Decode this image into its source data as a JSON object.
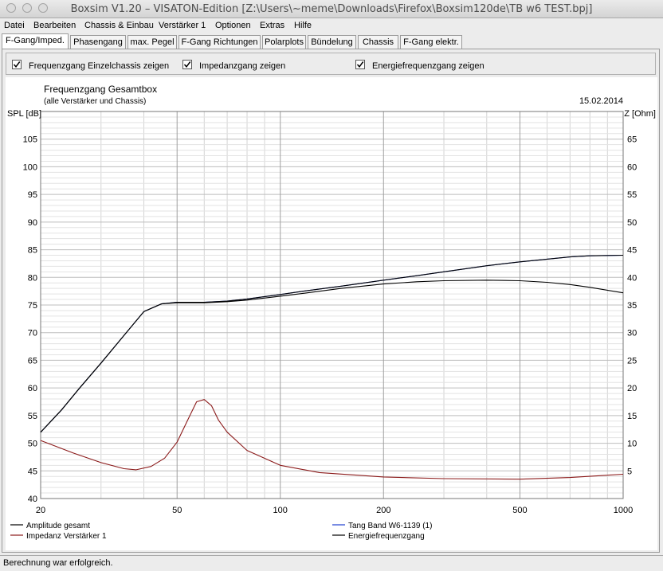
{
  "window": {
    "title": "Boxsim V1.20 – VISATON-Edition [Z:\\Users\\~meme\\Downloads\\Firefox\\Boxsim120de\\TB w6 TEST.bpj]"
  },
  "menu": [
    "Datei",
    "Bearbeiten",
    "Chassis & Einbau",
    "Verstärker 1",
    "Optionen",
    "Extras",
    "Hilfe"
  ],
  "tabs": [
    "F-Gang/Imped.",
    "Phasengang",
    "max. Pegel",
    "F-Gang Richtungen",
    "Polarplots",
    "Bündelung",
    "Chassis",
    "F-Gang elektr."
  ],
  "active_tab": "F-Gang/Imped.",
  "options": {
    "einzelchassis": {
      "label": "Frequenzgang Einzelchassis zeigen",
      "checked": true
    },
    "impedanz": {
      "label": "Impedanzgang zeigen",
      "checked": true
    },
    "energie": {
      "label": "Energiefrequenzgang zeigen",
      "checked": true
    }
  },
  "status": "Berechnung war erfolgreich.",
  "chart_data": {
    "type": "line",
    "title": "Frequenzgang Gesamtbox",
    "subtitle": "(alle Verstärker und Chassis)",
    "date": "15.02.2014",
    "ylabel": "SPL [dB]",
    "y2label": "Z [Ohm]",
    "x_scale": "log",
    "xlim": [
      20,
      1000
    ],
    "ylim": [
      40,
      110
    ],
    "y2lim": [
      0,
      70
    ],
    "x_ticks": [
      20,
      50,
      100,
      200,
      500,
      1000
    ],
    "y_ticks": [
      40,
      45,
      50,
      55,
      60,
      65,
      70,
      75,
      80,
      85,
      90,
      95,
      100,
      105
    ],
    "y2_ticks": [
      5,
      10,
      15,
      20,
      25,
      30,
      35,
      40,
      45,
      50,
      55,
      60,
      65
    ],
    "grid": true,
    "legend": [
      {
        "name": "Amplitude gesamt",
        "color": "#000000"
      },
      {
        "name": "Tang Band W6-1139 (1)",
        "color": "#1f3fd0"
      },
      {
        "name": "Impedanz Verstärker 1",
        "color": "#8b1a1a"
      },
      {
        "name": "Energiefrequenzgang",
        "color": "#000000"
      }
    ],
    "series": [
      {
        "name": "Amplitude gesamt",
        "axis": "left",
        "color": "#000000",
        "x": [
          20,
          23,
          26,
          30,
          35,
          40,
          45,
          50,
          60,
          70,
          80,
          100,
          120,
          150,
          200,
          250,
          300,
          400,
          500,
          600,
          700,
          800,
          1000
        ],
        "y": [
          52,
          56,
          60,
          64.5,
          69.5,
          73.8,
          75.2,
          75.5,
          75.5,
          75.7,
          76.1,
          76.9,
          77.6,
          78.4,
          79.5,
          80.3,
          81.0,
          82.1,
          82.8,
          83.3,
          83.7,
          83.9,
          84.0
        ]
      },
      {
        "name": "Tang Band W6-1139 (1)",
        "axis": "left",
        "color": "#1f3fd0",
        "x": [
          20,
          23,
          26,
          30,
          35,
          40,
          45,
          50,
          60,
          70,
          80,
          100,
          120,
          150,
          200,
          250,
          300,
          400,
          500,
          600,
          700,
          800,
          1000
        ],
        "y": [
          52,
          56,
          60,
          64.5,
          69.5,
          73.8,
          75.2,
          75.5,
          75.5,
          75.7,
          76.1,
          76.9,
          77.6,
          78.4,
          79.5,
          80.3,
          81.0,
          82.1,
          82.8,
          83.3,
          83.7,
          83.9,
          84.0
        ]
      },
      {
        "name": "Energiefrequenzgang",
        "axis": "left",
        "color": "#000000",
        "x": [
          20,
          23,
          26,
          30,
          35,
          40,
          45,
          50,
          60,
          70,
          80,
          100,
          120,
          150,
          200,
          250,
          300,
          400,
          500,
          600,
          700,
          800,
          1000
        ],
        "y": [
          52,
          56,
          60,
          64.5,
          69.5,
          73.8,
          75.2,
          75.4,
          75.4,
          75.6,
          75.9,
          76.6,
          77.2,
          78.0,
          78.8,
          79.2,
          79.4,
          79.5,
          79.4,
          79.1,
          78.7,
          78.2,
          77.2
        ]
      },
      {
        "name": "Impedanz Verstärker 1",
        "axis": "right",
        "color": "#8b1a1a",
        "x": [
          20,
          25,
          30,
          35,
          38,
          42,
          46,
          50,
          54,
          57,
          60,
          63,
          66,
          70,
          80,
          100,
          130,
          200,
          300,
          500,
          700,
          1000
        ],
        "y": [
          10.5,
          8.2,
          6.5,
          5.4,
          5.2,
          5.8,
          7.3,
          10.2,
          14.5,
          17.5,
          17.9,
          16.8,
          14.2,
          12.0,
          8.7,
          6.0,
          4.7,
          3.9,
          3.6,
          3.5,
          3.8,
          4.4
        ]
      }
    ]
  }
}
